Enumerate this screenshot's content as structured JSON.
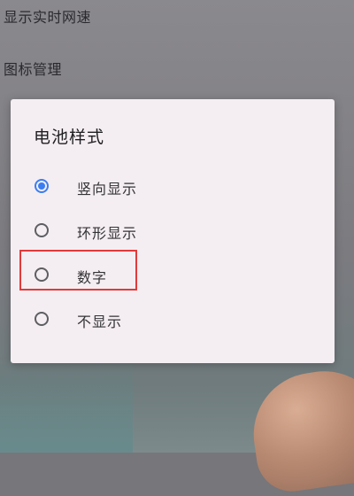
{
  "background_settings": [
    {
      "label": "显示实时网速"
    },
    {
      "label": "图标管理"
    }
  ],
  "dialog": {
    "title": "电池样式",
    "options": [
      {
        "label": "竖向显示",
        "selected": true
      },
      {
        "label": "环形显示",
        "selected": false
      },
      {
        "label": "数字",
        "selected": false
      },
      {
        "label": "不显示",
        "selected": false
      }
    ]
  },
  "colors": {
    "accent": "#3a7ef2",
    "highlight_box": "#e23a3a",
    "dialog_bg": "#f4eef2"
  }
}
